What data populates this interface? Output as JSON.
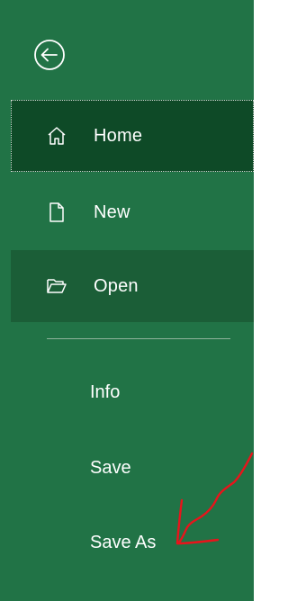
{
  "back": {
    "icon": "back-arrow-circle-icon"
  },
  "nav": {
    "home": {
      "label": "Home",
      "icon": "home-icon"
    },
    "new": {
      "label": "New",
      "icon": "new-document-icon"
    },
    "open": {
      "label": "Open",
      "icon": "open-folder-icon"
    }
  },
  "menu": {
    "info": "Info",
    "save": "Save",
    "save_as": "Save As"
  },
  "colors": {
    "backstage_bg": "#217346",
    "selected_bg": "#0e4a27",
    "hover_bg": "#1b5e37",
    "annotation": "#e8141b"
  }
}
